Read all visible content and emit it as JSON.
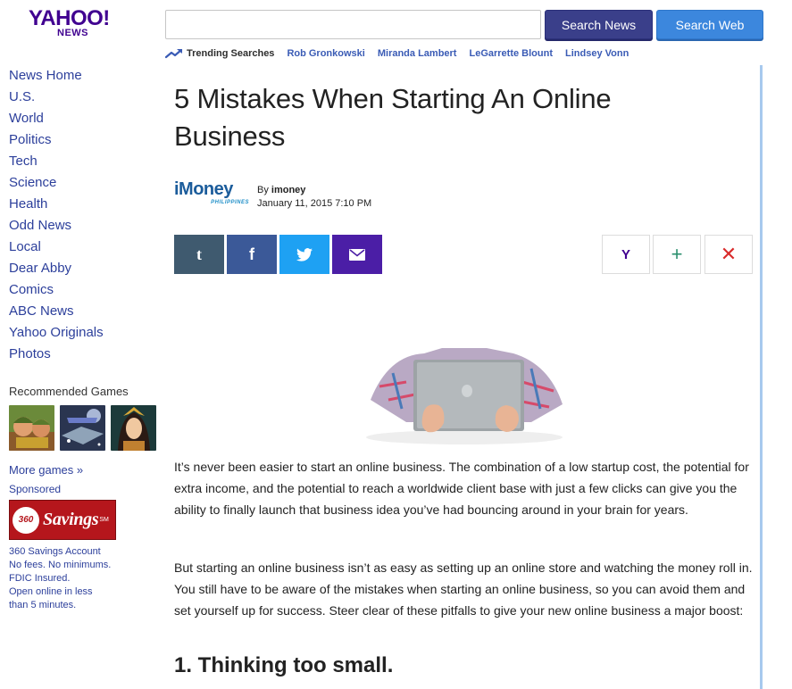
{
  "brand": {
    "logo_text": "YAHOO!",
    "logo_sub": "NEWS",
    "color": "#400090"
  },
  "search": {
    "value": "",
    "placeholder": "",
    "news_button": "Search News",
    "web_button": "Search Web"
  },
  "trending": {
    "label": "Trending Searches",
    "items": [
      "Rob Gronkowski",
      "Miranda Lambert",
      "LeGarrette Blount",
      "Lindsey Vonn"
    ]
  },
  "nav": {
    "items": [
      "News Home",
      "U.S.",
      "World",
      "Politics",
      "Tech",
      "Science",
      "Health",
      "Odd News",
      "Local",
      "Dear Abby",
      "Comics",
      "ABC News",
      "Yahoo Originals",
      "Photos"
    ]
  },
  "games": {
    "title": "Recommended Games",
    "more": "More games »",
    "thumbs": [
      "soldier-game-thumb",
      "astro-game-thumb",
      "fantasy-game-thumb"
    ]
  },
  "ad": {
    "sponsored": "Sponsored",
    "brand_num": "360",
    "brand_word": "Savings",
    "brand_mark": "SM",
    "lines": [
      "360 Savings Account",
      "No fees. No minimums.",
      "FDIC Insured.",
      "Open online in less",
      "than 5 minutes."
    ]
  },
  "article": {
    "title": "5 Mistakes When Starting An Online Business",
    "publisher_logo": "iMoney",
    "publisher_sub": "PHILIPPINES",
    "by_prefix": "By",
    "author": "imoney",
    "date": "January 11, 2015 7:10 PM",
    "paragraph1": "It’s never been easier to start an online business. The combination of a low startup cost, the potential for extra income, and the potential to reach a worldwide client base with just a few clicks can give you the ability to finally launch that business idea you’ve had bouncing around in your brain for years.",
    "paragraph2": "But starting an online business isn’t as easy as setting up an online store and watching the money roll in. You still have to be aware of the mistakes when starting an online business, so you can avoid them and set yourself up for success. Steer clear of these pitfalls to give your new online business a major boost:",
    "subhead": "1. Thinking too small."
  },
  "share": {
    "tumblr": "t",
    "facebook": "f"
  },
  "actions": {
    "yahoo": "Y",
    "add": "+",
    "close": "✕"
  },
  "colors": {
    "search_news_btn": "#3a3f8a",
    "search_web_btn": "#3c87dd",
    "link": "#2c3f9b",
    "tumblr": "#3f5a6f",
    "facebook": "#3b5998",
    "twitter": "#1ea1f3",
    "mail": "#4b1ea6",
    "ad_red": "#b5161c"
  }
}
